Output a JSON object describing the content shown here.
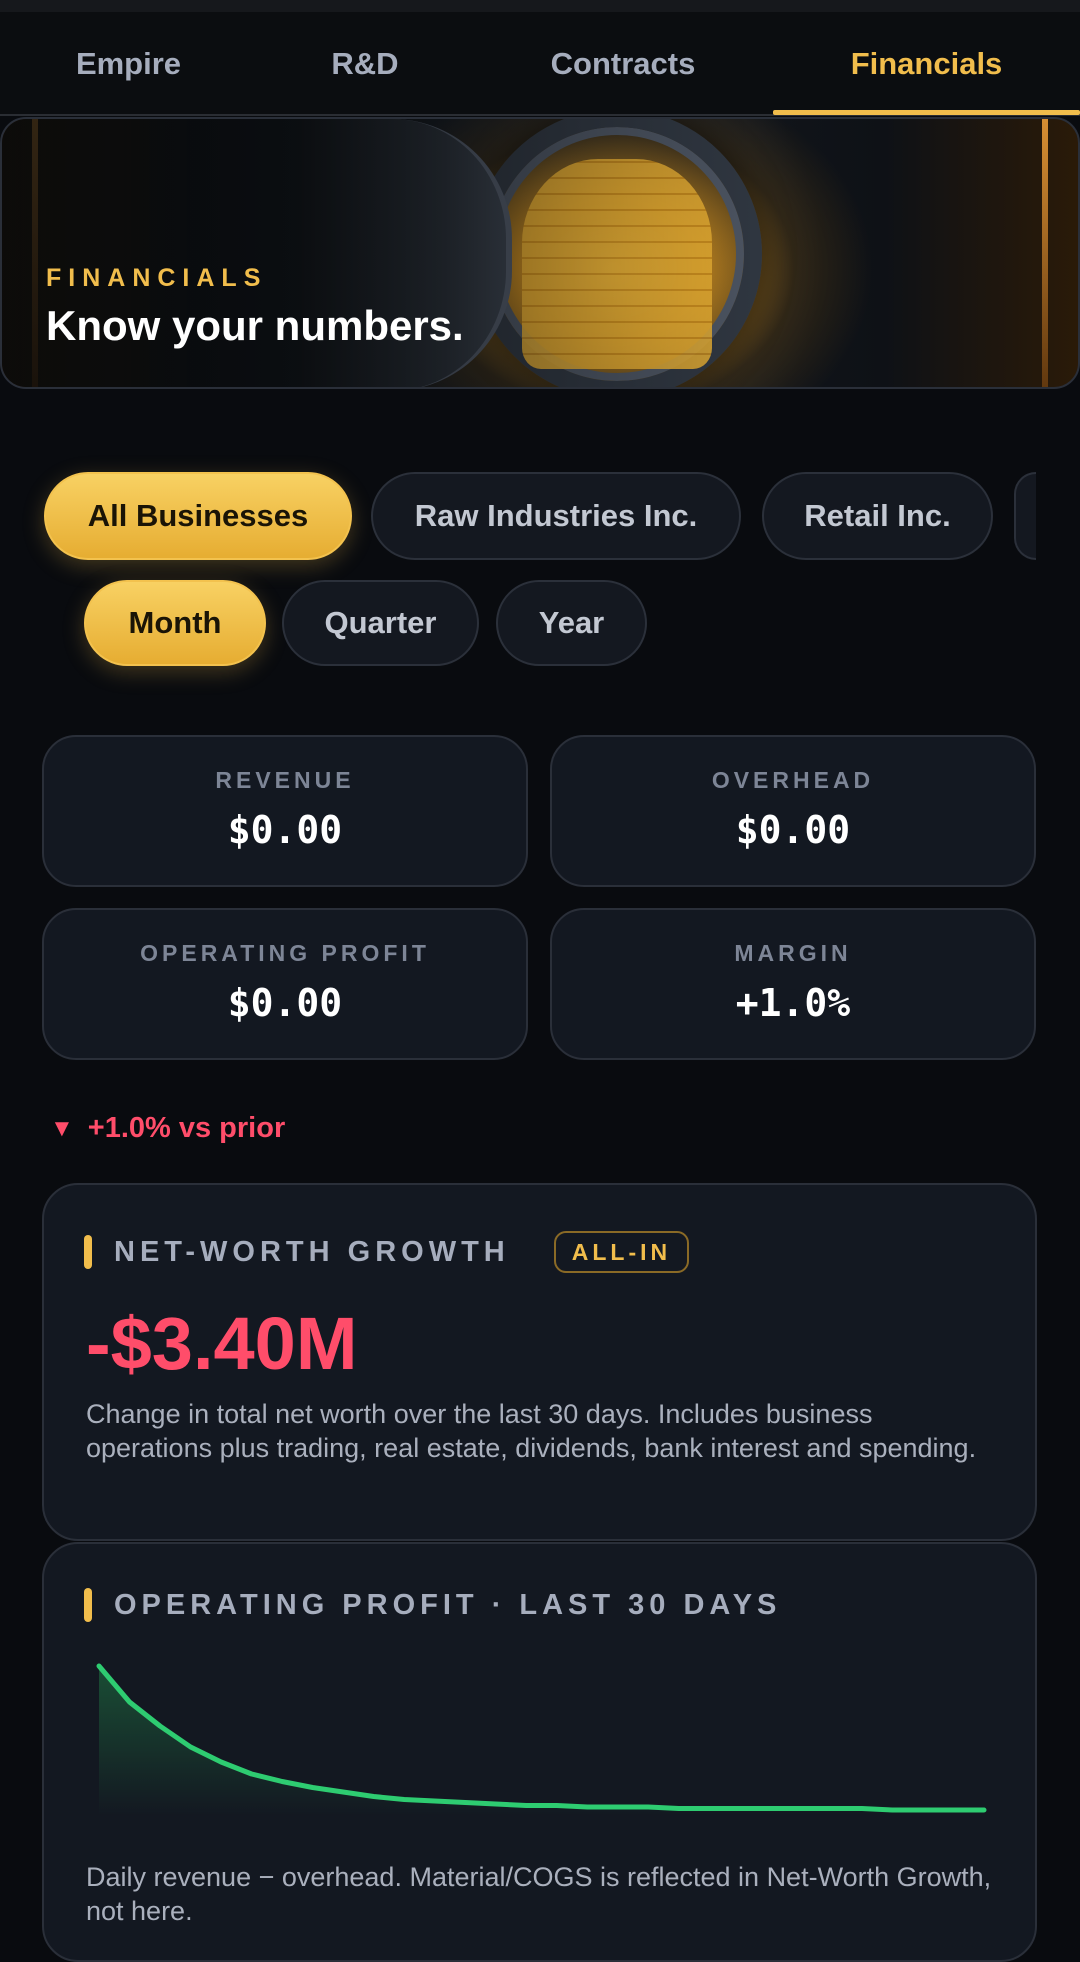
{
  "tabs": [
    {
      "label": "Empire",
      "active": false
    },
    {
      "label": "R&D",
      "active": false
    },
    {
      "label": "Contracts",
      "active": false
    },
    {
      "label": "Financials",
      "active": true
    }
  ],
  "hero": {
    "kicker": "FINANCIALS",
    "title": "Know your numbers."
  },
  "business_filters": [
    {
      "label": "All Businesses",
      "active": true
    },
    {
      "label": "Raw Industries Inc.",
      "active": false
    },
    {
      "label": "Retail Inc.",
      "active": false
    }
  ],
  "period_filters": [
    {
      "label": "Month",
      "active": true
    },
    {
      "label": "Quarter",
      "active": false
    },
    {
      "label": "Year",
      "active": false
    }
  ],
  "stats": {
    "revenue": {
      "label": "REVENUE",
      "value": "$0.00"
    },
    "overhead": {
      "label": "OVERHEAD",
      "value": "$0.00"
    },
    "operating_profit": {
      "label": "OPERATING PROFIT",
      "value": "$0.00"
    },
    "margin": {
      "label": "MARGIN",
      "value": "+1.0%"
    }
  },
  "delta": {
    "text": "+1.0% vs prior",
    "direction": "down"
  },
  "net_worth": {
    "title": "NET-WORTH GROWTH",
    "badge": "ALL-IN",
    "value": "-$3.40M",
    "description": "Change in total net worth over the last 30 days. Includes business operations plus trading, real estate, dividends, bank interest and spending."
  },
  "operating_chart": {
    "title": "OPERATING PROFIT · LAST 30 DAYS",
    "description": "Daily revenue − overhead. Material/COGS is reflected in Net-Worth Growth, not here."
  },
  "colors": {
    "accent": "#f1bd4c",
    "negative": "#ff4d6a",
    "chart_line": "#2ecc71",
    "background": "#090b0f",
    "card": "#131821"
  },
  "chart_data": {
    "type": "area",
    "title": "OPERATING PROFIT · LAST 30 DAYS",
    "xlabel": "",
    "ylabel": "",
    "grid": false,
    "legend": "none",
    "x": [
      1,
      2,
      3,
      4,
      5,
      6,
      7,
      8,
      9,
      10,
      11,
      12,
      13,
      14,
      15,
      16,
      17,
      18,
      19,
      20,
      21,
      22,
      23,
      24,
      25,
      26,
      27,
      28,
      29,
      30
    ],
    "y": [
      1.0,
      0.76,
      0.6,
      0.46,
      0.36,
      0.28,
      0.23,
      0.19,
      0.16,
      0.13,
      0.11,
      0.1,
      0.09,
      0.08,
      0.07,
      0.07,
      0.06,
      0.06,
      0.06,
      0.05,
      0.05,
      0.05,
      0.05,
      0.05,
      0.05,
      0.05,
      0.04,
      0.04,
      0.04,
      0.04
    ],
    "ylim": [
      0,
      1
    ]
  }
}
